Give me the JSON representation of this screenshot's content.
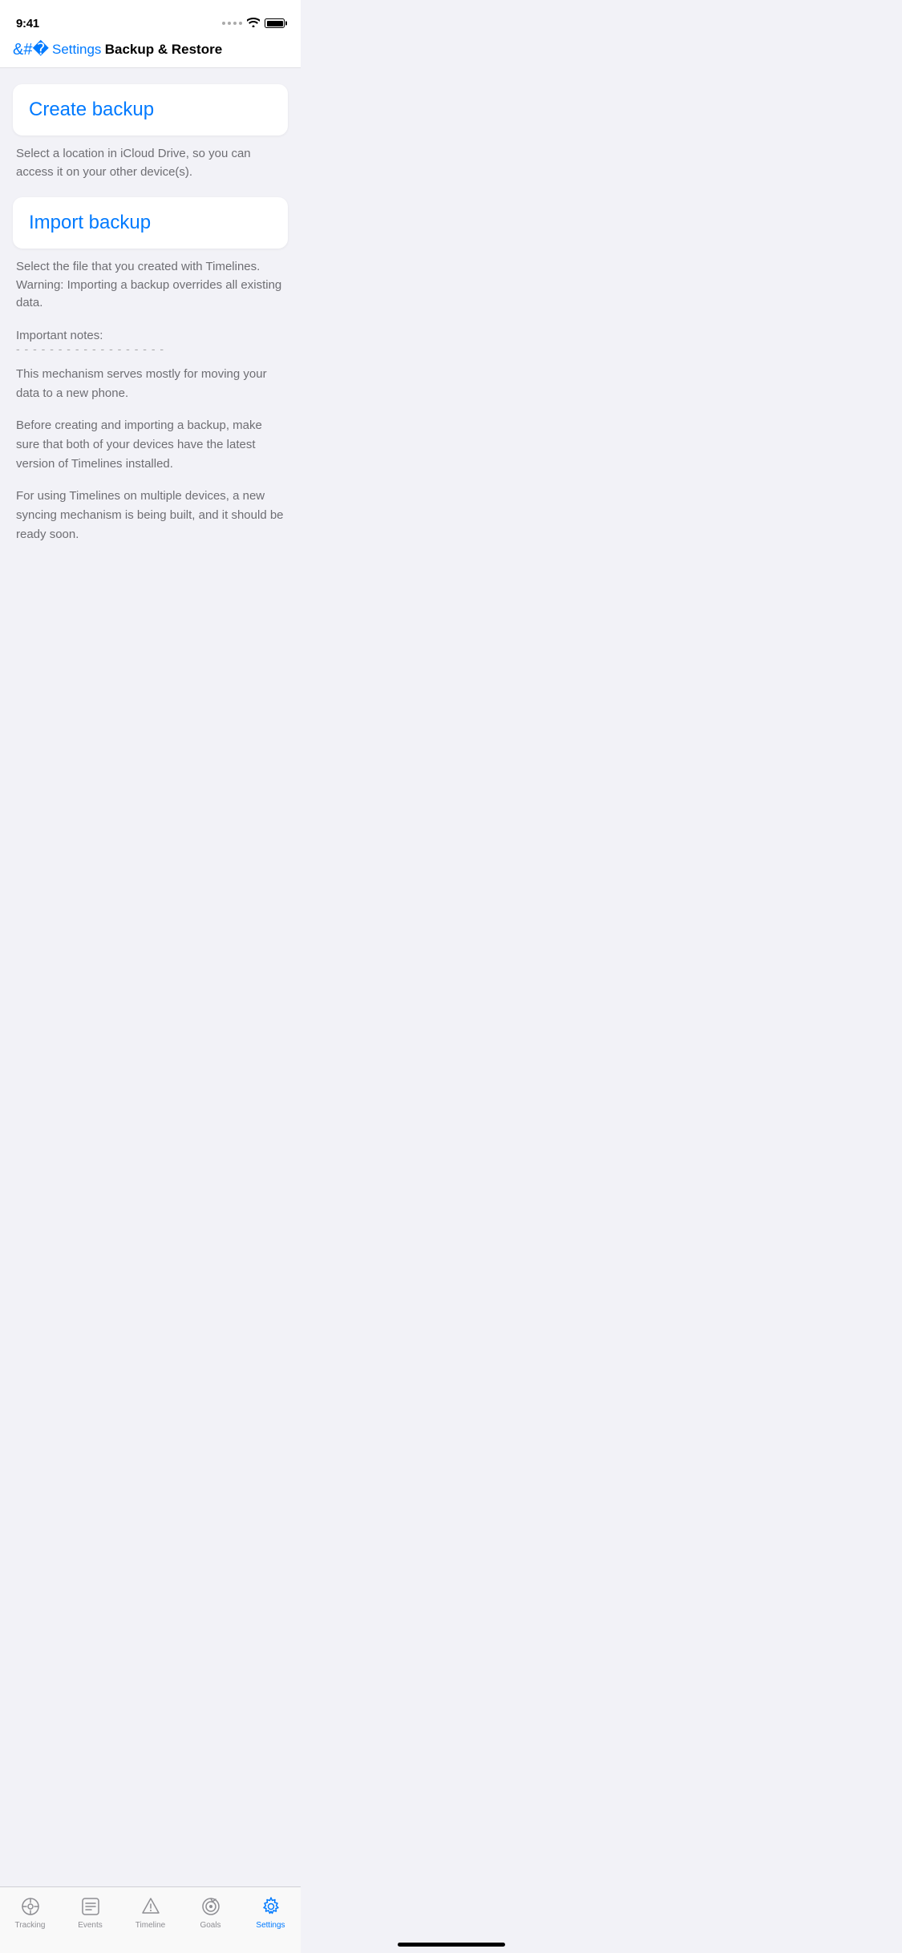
{
  "statusBar": {
    "time": "9:41"
  },
  "navBar": {
    "backLabel": "Settings",
    "title": "Backup & Restore"
  },
  "createBackup": {
    "cardTitle": "Create backup",
    "description": "Select a location in iCloud Drive, so you can access it on your other device(s)."
  },
  "importBackup": {
    "cardTitle": "Import backup",
    "descriptionLine1": "Select the file that you created with Timelines. Warning: Importing a backup overrides all existing data.",
    "notesLabel": "Important notes:",
    "notesDivider": "- - - - - - - - - - - - - - - - - -",
    "note1": "This mechanism serves mostly for moving your data to a new phone.",
    "note2": "Before creating and importing a backup, make sure that both of your devices have the latest version of Timelines installed.",
    "note3": "For using Timelines on multiple devices, a new syncing mechanism is being built, and it should be ready soon."
  },
  "tabBar": {
    "items": [
      {
        "label": "Tracking",
        "id": "tracking",
        "active": false
      },
      {
        "label": "Events",
        "id": "events",
        "active": false
      },
      {
        "label": "Timeline",
        "id": "timeline",
        "active": false
      },
      {
        "label": "Goals",
        "id": "goals",
        "active": false
      },
      {
        "label": "Settings",
        "id": "settings",
        "active": true
      }
    ]
  }
}
